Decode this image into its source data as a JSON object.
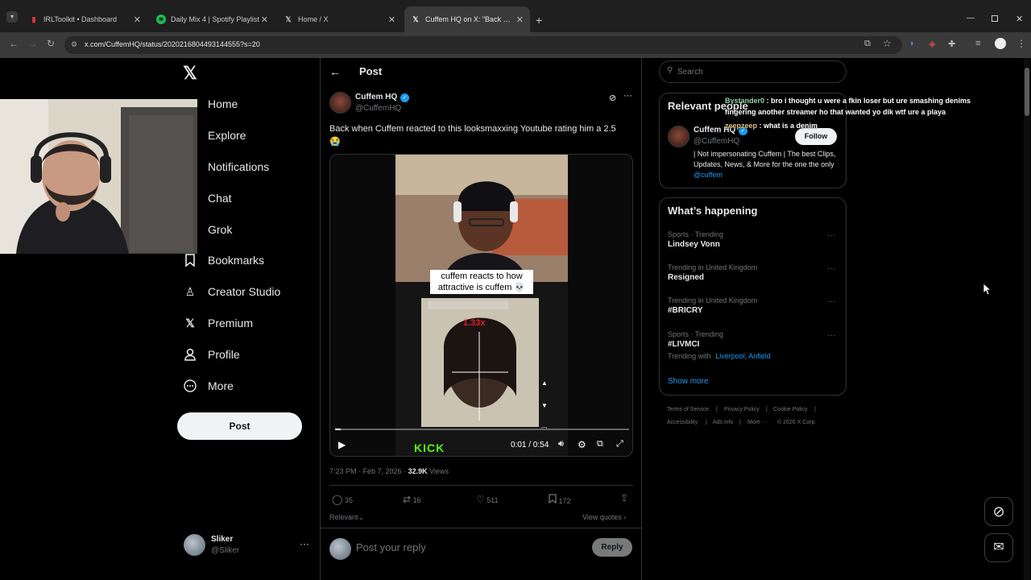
{
  "browser": {
    "tabs": [
      {
        "title": "IRLToolkit • Dashboard",
        "icon": "irltoolkit-icon"
      },
      {
        "title": "Daily Mix 4 | Spotify Playlist",
        "icon": "spotify-icon"
      },
      {
        "title": "Home / X",
        "icon": "x-logo-icon"
      },
      {
        "title": "Cuffem HQ on X: \"Back when C",
        "icon": "x-logo-icon"
      }
    ],
    "url": "x.com/CuffemHQ/status/2020216804493144555?s=20"
  },
  "sidebar": {
    "items": [
      {
        "label": "Home",
        "icon": "home-icon"
      },
      {
        "label": "Explore",
        "icon": "search-icon"
      },
      {
        "label": "Notifications",
        "icon": "bell-icon"
      },
      {
        "label": "Chat",
        "icon": "chat-icon"
      },
      {
        "label": "Grok",
        "icon": "grok-icon"
      },
      {
        "label": "Bookmarks",
        "icon": "bookmark-icon"
      },
      {
        "label": "Creator Studio",
        "icon": "creator-studio-icon"
      },
      {
        "label": "Premium",
        "icon": "x-logo-icon"
      },
      {
        "label": "Profile",
        "icon": "person-icon"
      },
      {
        "label": "More",
        "icon": "more-circle-icon"
      }
    ],
    "post_button": "Post",
    "account": {
      "name": "Sliker",
      "handle": "@Sliker"
    }
  },
  "post": {
    "header_title": "Post",
    "author_name": "Cuffem HQ",
    "author_handle": "@CuffemHQ",
    "text": "Back when Cuffem reacted to this looksmaxxing Youtube rating him a 2.5 😭",
    "video": {
      "caption": "cuffem reacts to how attractive is cuffem 💀",
      "rating_text": "1.33x",
      "watermark": "KICK",
      "time": "0:01 / 0:54",
      "progress": 0.02
    },
    "timestamp": "7:23 PM · Feb 7, 2026 · ",
    "views_count": "32.9K",
    "views_label": " Views",
    "stats": {
      "replies": "35",
      "reposts": "16",
      "likes": "511",
      "bookmarks": "172"
    },
    "sort_label": "Relevant",
    "view_quotes": "View quotes",
    "reply_placeholder": "Post your reply",
    "reply_button": "Reply"
  },
  "right": {
    "search_placeholder": "Search",
    "relevant_title": "Relevant people",
    "person": {
      "name": "Cuffem HQ",
      "handle": "@CuffemHQ",
      "follow": "Follow",
      "bio": "| Not impersonating Cuffem | The best Clips, Updates, News, & More for the one the only ",
      "bio_link": "@cuffem"
    },
    "happening_title": "What’s happening",
    "trends": [
      {
        "category": "Sports · Trending",
        "name": "Lindsey Vonn"
      },
      {
        "category": "Trending in United Kingdom",
        "name": "Resigned"
      },
      {
        "category": "Trending in United Kingdom",
        "name": "#BRICRY"
      },
      {
        "category": "Sports · Trending",
        "name": "#LIVMCI",
        "extra_prefix": "Trending with ",
        "extra_links": "Liverpool, Anfield"
      }
    ],
    "show_more": "Show more",
    "footer": [
      "Terms of Service",
      "Privacy Policy",
      "Cookie Policy",
      "Accessibility",
      "Ads info",
      "More ···",
      "© 2026 X Corp."
    ]
  },
  "overlay_chat": [
    {
      "user": "Bystander0",
      "message": " : bro i thought u were a fkin loser but ure smashing denims fingering another streamer ho that wanted yo dik wtf ure a playa"
    },
    {
      "user": "zeepzeep",
      "message": " : what is a denim"
    }
  ],
  "colors": {
    "accent": "#1d9bf0",
    "background": "#000000",
    "border": "#2f3336",
    "muted": "#71767b",
    "chat_user": "#8fd6a6"
  }
}
